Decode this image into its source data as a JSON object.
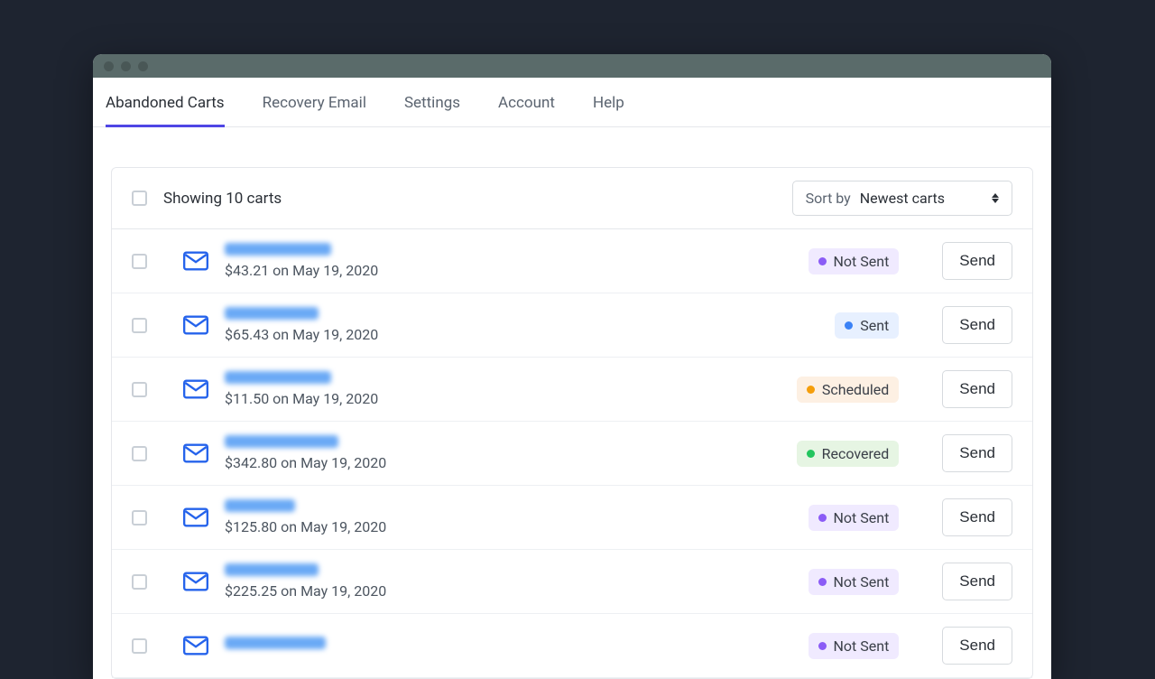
{
  "tabs": [
    {
      "label": "Abandoned Carts",
      "active": true
    },
    {
      "label": "Recovery Email",
      "active": false
    },
    {
      "label": "Settings",
      "active": false
    },
    {
      "label": "Account",
      "active": false
    },
    {
      "label": "Help",
      "active": false
    }
  ],
  "listhead": {
    "showing": "Showing 10 carts",
    "sort_by_label": "Sort by",
    "sort_value": "Newest carts"
  },
  "buttons": {
    "send": "Send"
  },
  "statuses": {
    "not_sent": "Not Sent",
    "sent": "Sent",
    "scheduled": "Scheduled",
    "recovered": "Recovered"
  },
  "rows": [
    {
      "name_width": 118,
      "amount": "$43.21",
      "date": "May 19, 2020",
      "status": "not_sent"
    },
    {
      "name_width": 104,
      "amount": "$65.43",
      "date": "May 19, 2020",
      "status": "sent"
    },
    {
      "name_width": 118,
      "amount": "$11.50",
      "date": "May 19, 2020",
      "status": "scheduled"
    },
    {
      "name_width": 126,
      "amount": "$342.80",
      "date": "May 19, 2020",
      "status": "recovered"
    },
    {
      "name_width": 78,
      "amount": "$125.80",
      "date": "May 19, 2020",
      "status": "not_sent"
    },
    {
      "name_width": 104,
      "amount": "$225.25",
      "date": "May 19, 2020",
      "status": "not_sent"
    },
    {
      "name_width": 112,
      "amount": "",
      "date": "",
      "status": "not_sent"
    }
  ],
  "status_class": {
    "not_sent": "b-notsent",
    "sent": "b-sent",
    "scheduled": "b-scheduled",
    "recovered": "b-recovered"
  }
}
